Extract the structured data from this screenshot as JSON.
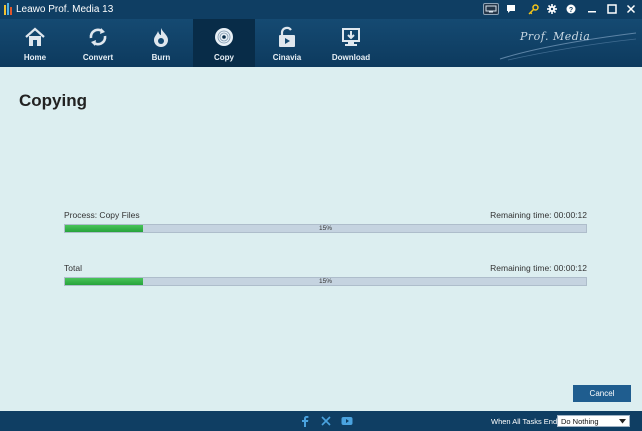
{
  "window": {
    "title": "Leawo Prof. Media 13"
  },
  "toolbar": {
    "items": [
      {
        "label": "Home",
        "icon": "home-icon"
      },
      {
        "label": "Convert",
        "icon": "convert-icon"
      },
      {
        "label": "Burn",
        "icon": "burn-icon"
      },
      {
        "label": "Copy",
        "icon": "copy-disc-icon",
        "active": true
      },
      {
        "label": "Cinavia",
        "icon": "cinavia-icon"
      },
      {
        "label": "Download",
        "icon": "download-icon"
      }
    ],
    "brand": "Prof. Media"
  },
  "main": {
    "title": "Copying",
    "process": {
      "label": "Process: Copy Files",
      "remaining": "Remaining time: 00:00:12",
      "percent_text": "15%",
      "percent": 15
    },
    "total": {
      "label": "Total",
      "remaining": "Remaining time: 00:00:12",
      "percent_text": "15%",
      "percent": 15
    },
    "cancel_label": "Cancel"
  },
  "footer": {
    "when_label": "When All Tasks End:",
    "when_value": "Do Nothing"
  },
  "colors": {
    "titlebar": "#0f3e63",
    "background": "#dceef0",
    "progress_fill": "#2fb043",
    "progress_track": "#c5d3e0",
    "cancel_button": "#1f5d8f"
  }
}
